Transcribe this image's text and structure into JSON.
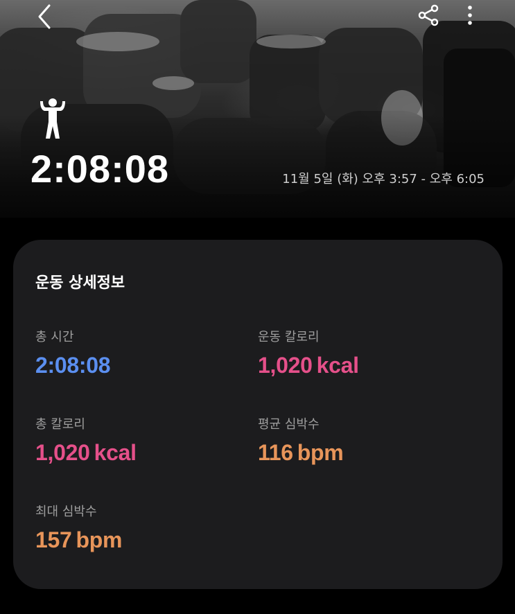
{
  "header": {
    "duration": "2:08:08",
    "date_range": "11월 5일 (화) 오후 3:57 - 오후 6:05",
    "back_icon": "chevron-left-icon",
    "share_icon": "share-icon",
    "more_icon": "more-vert-icon",
    "exercise_icon": "weightlifting-person-icon"
  },
  "details": {
    "title": "운동 상세정보",
    "stats": [
      {
        "label": "총 시간",
        "value": "2:08:08",
        "unit": "",
        "color": "#5b8ff0"
      },
      {
        "label": "운동 칼로리",
        "value": "1,020",
        "unit": "kcal",
        "color": "#e5508a"
      },
      {
        "label": "총 칼로리",
        "value": "1,020",
        "unit": "kcal",
        "color": "#e5508a"
      },
      {
        "label": "평균 심박수",
        "value": "116",
        "unit": "bpm",
        "color": "#e8955a"
      },
      {
        "label": "최대 심박수",
        "value": "157",
        "unit": "bpm",
        "color": "#e8955a"
      }
    ]
  },
  "colors": {
    "background": "#000000",
    "card": "#1c1c1e",
    "label": "#9e9e9e"
  }
}
